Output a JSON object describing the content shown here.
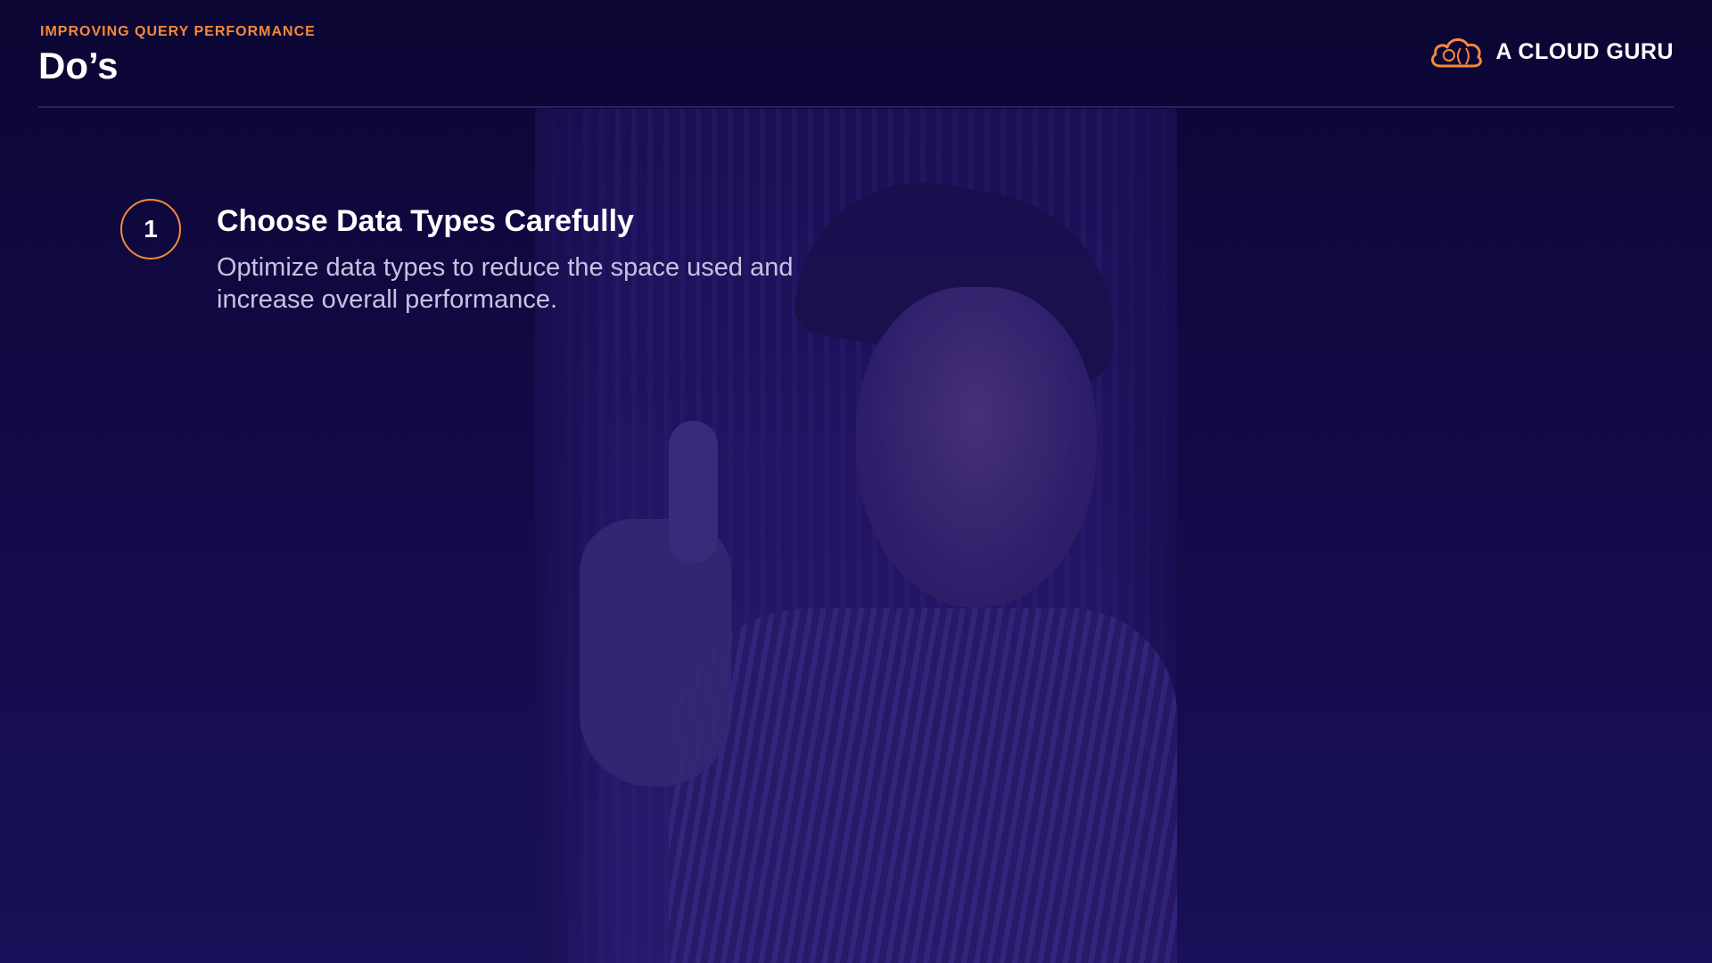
{
  "header": {
    "eyebrow": "IMPROVING QUERY PERFORMANCE",
    "title": "Do’s"
  },
  "brand": {
    "name": "A CLOUD GURU",
    "icon": "cloud-logo-icon",
    "accent_color": "#f48a3a"
  },
  "items": [
    {
      "number": "1",
      "title": "Choose Data Types Carefully",
      "description": "Optimize data types to reduce the space used and increase overall performance."
    }
  ],
  "colors": {
    "background_top": "#0b0633",
    "background_bottom": "#181058",
    "accent": "#f48a3a",
    "description_text": "#c7c2e0"
  }
}
